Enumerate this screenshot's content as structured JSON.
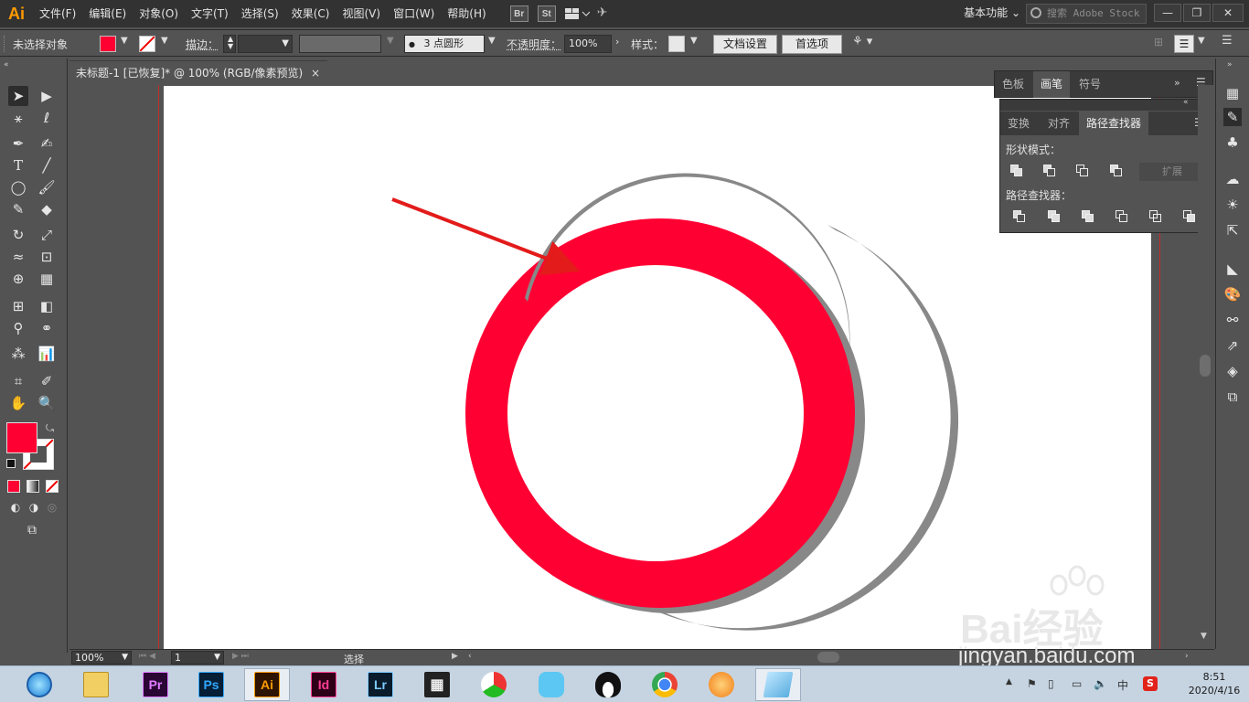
{
  "app": {
    "logo": "Ai"
  },
  "menu": [
    "文件(F)",
    "编辑(E)",
    "对象(O)",
    "文字(T)",
    "选择(S)",
    "效果(C)",
    "视图(V)",
    "窗口(W)",
    "帮助(H)"
  ],
  "menubar_icons": {
    "bridge": "Br",
    "stock": "St"
  },
  "workspace": "基本功能",
  "search": {
    "placeholder": "搜索 Adobe Stock"
  },
  "window_controls": {
    "minimize": "—",
    "restore": "❐",
    "close": "✕"
  },
  "control": {
    "selection_label": "未选择对象",
    "fill_color": "#ff0033",
    "stroke_label": "描边：",
    "brush_value": "3 点圆形",
    "opacity_label": "不透明度：",
    "opacity_value": "100%",
    "style_label": "样式：",
    "doc_setup_button": "文档设置",
    "prefs_button": "首选项"
  },
  "document": {
    "tab_title": "未标题-1 [已恢复]* @ 100% (RGB/像素预览)",
    "close": "×"
  },
  "panels": {
    "top_tabs": [
      "色板",
      "画笔",
      "符号"
    ],
    "top_active": 1,
    "pf_tabs": [
      "变换",
      "对齐",
      "路径查找器"
    ],
    "pf_active": 2,
    "shape_modes_label": "形状模式：",
    "pathfinder_label": "路径查找器：",
    "expand_button": "扩展"
  },
  "status": {
    "zoom": "100%",
    "page": "1",
    "tool": "选择"
  },
  "artwork": {
    "ring_color": "#ff0033",
    "shadow_color": "#888888",
    "arrow_color": "#e31b1b"
  },
  "taskbar": {
    "apps": [
      "Pr",
      "Ps",
      "Ai",
      "Id",
      "Lr"
    ],
    "time": "8:51",
    "date": "2020/4/16",
    "ime": "中"
  },
  "watermark": {
    "line1": "Bai经验",
    "line2": "jingyan.baidu.com"
  }
}
